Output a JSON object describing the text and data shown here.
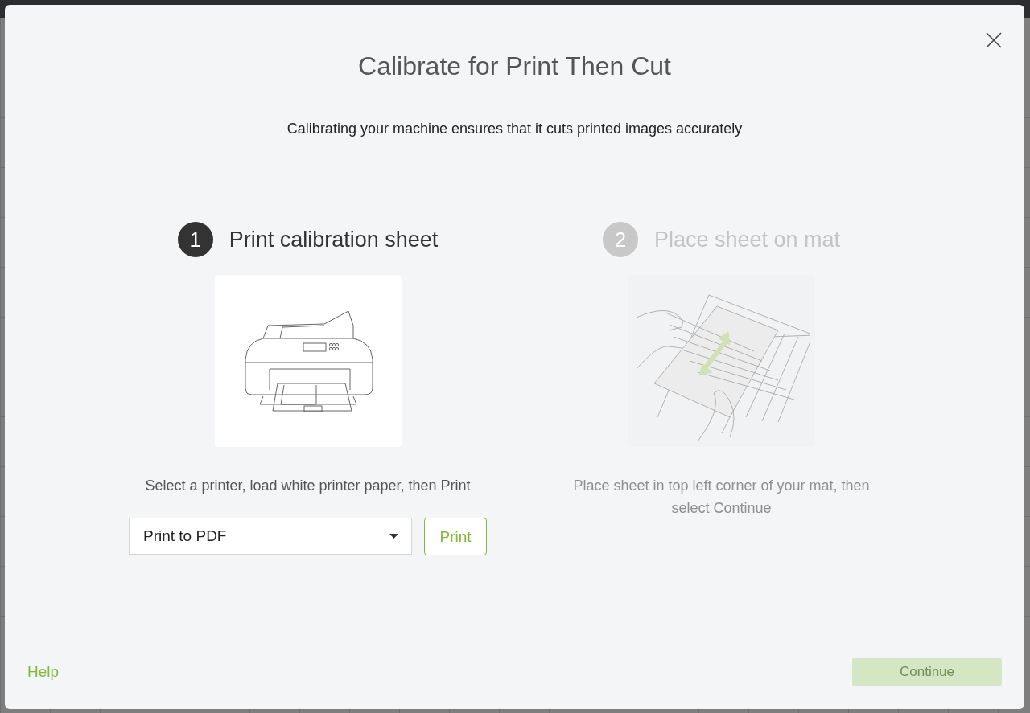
{
  "dialog": {
    "title": "Calibrate for Print Then Cut",
    "subtitle": "Calibrating your machine ensures that it cuts printed images accurately",
    "steps": [
      {
        "number": "1",
        "title": "Print calibration sheet",
        "active": true,
        "kind": "printer",
        "description": "Select a printer, load white printer paper, then Print"
      },
      {
        "number": "2",
        "title": "Place sheet on mat",
        "active": false,
        "kind": "mat",
        "description": "Place sheet in top left corner of your mat, then select Continue"
      }
    ],
    "printer_select": {
      "value": "Print to PDF"
    },
    "print_button": "Print",
    "help_link": "Help",
    "continue_button": {
      "label": "Continue",
      "disabled": true
    }
  }
}
